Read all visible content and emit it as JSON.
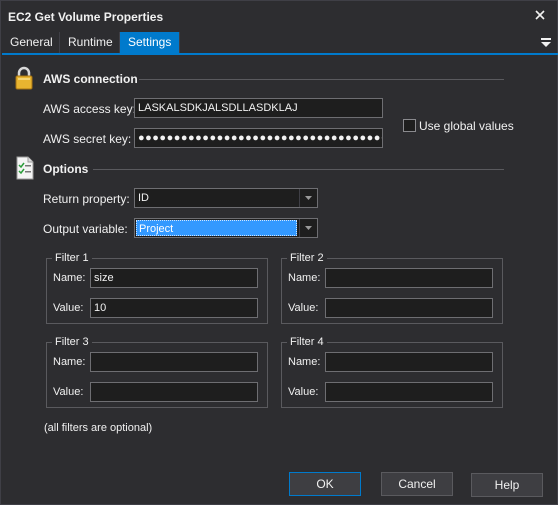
{
  "window": {
    "title": "EC2 Get Volume Properties"
  },
  "tabs": [
    {
      "label": "General",
      "active": false
    },
    {
      "label": "Runtime",
      "active": false
    },
    {
      "label": "Settings",
      "active": true
    }
  ],
  "aws_connection": {
    "heading": "AWS connection",
    "access_key_label": "AWS access key:",
    "access_key_value": "LASKALSDKJALSDLLASDKLAJ",
    "secret_key_label": "AWS secret key:",
    "secret_key_value": "●●●●●●●●●●●●●●●●●●●●●●●●●●●●●●●●●●●●●●●●",
    "use_global_label": "Use global values",
    "use_global_checked": false
  },
  "options": {
    "heading": "Options",
    "return_property_label": "Return property:",
    "return_property_value": "ID",
    "output_variable_label": "Output variable:",
    "output_variable_value": "Project"
  },
  "filters": [
    {
      "title": "Filter 1",
      "name_label": "Name:",
      "name_value": "size",
      "value_label": "Value:",
      "value_value": "10"
    },
    {
      "title": "Filter 2",
      "name_label": "Name:",
      "name_value": "",
      "value_label": "Value:",
      "value_value": ""
    },
    {
      "title": "Filter 3",
      "name_label": "Name:",
      "name_value": "",
      "value_label": "Value:",
      "value_value": ""
    },
    {
      "title": "Filter 4",
      "name_label": "Name:",
      "name_value": "",
      "value_label": "Value:",
      "value_value": ""
    }
  ],
  "filters_note": "(all filters are optional)",
  "buttons": {
    "ok": "OK",
    "cancel": "Cancel",
    "help": "Help"
  },
  "colors": {
    "accent": "#007acc",
    "background": "#2d2d30",
    "selection": "#3399ff"
  },
  "icons": [
    "close-icon",
    "menu-icon",
    "lock-icon",
    "checklist-icon",
    "dropdown-arrow-icon"
  ]
}
